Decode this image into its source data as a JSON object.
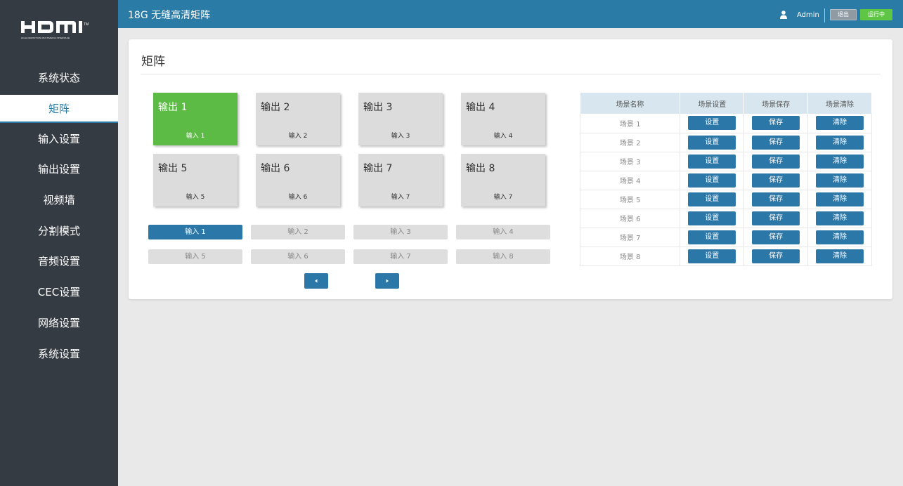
{
  "logo": {
    "tagline": "HIGH-DEFINITION MULTIMEDIA INTERFACE"
  },
  "sidebar": {
    "items": [
      {
        "label": "系统状态"
      },
      {
        "label": "矩阵"
      },
      {
        "label": "输入设置"
      },
      {
        "label": "输出设置"
      },
      {
        "label": "视频墙"
      },
      {
        "label": "分割模式"
      },
      {
        "label": "音频设置"
      },
      {
        "label": "CEC设置"
      },
      {
        "label": "网络设置"
      },
      {
        "label": "系统设置"
      }
    ],
    "active_index": 1
  },
  "topbar": {
    "title": "18G 无缝高清矩阵",
    "user": "Admin",
    "logout_label": "退出",
    "status_label": "运行中"
  },
  "page": {
    "title": "矩阵"
  },
  "outputs": [
    {
      "name": "输出 1",
      "input": "输入 1",
      "selected": true
    },
    {
      "name": "输出 2",
      "input": "输入 2"
    },
    {
      "name": "输出 3",
      "input": "输入 3"
    },
    {
      "name": "输出 4",
      "input": "输入 4"
    },
    {
      "name": "输出 5",
      "input": "输入 5"
    },
    {
      "name": "输出 6",
      "input": "输入 6"
    },
    {
      "name": "输出 7",
      "input": "输入 7"
    },
    {
      "name": "输出 8",
      "input": "输入 7"
    }
  ],
  "inputs": [
    {
      "label": "输入 1",
      "selected": true
    },
    {
      "label": "输入 2"
    },
    {
      "label": "输入 3"
    },
    {
      "label": "输入 4"
    },
    {
      "label": "输入 5"
    },
    {
      "label": "输入 6"
    },
    {
      "label": "输入 7"
    },
    {
      "label": "输入 8"
    }
  ],
  "scenes": {
    "headers": [
      "场景名称",
      "场景设置",
      "场景保存",
      "场景清除"
    ],
    "set_label": "设置",
    "save_label": "保存",
    "clear_label": "清除",
    "rows": [
      "场景 1",
      "场景 2",
      "场景 3",
      "场景 4",
      "场景 5",
      "场景 6",
      "场景 7",
      "场景 8"
    ]
  },
  "colors": {
    "accent": "#2b77a8",
    "active_tile": "#5cbb45",
    "sidebar": "#353b42",
    "status_green": "#5ec545"
  }
}
